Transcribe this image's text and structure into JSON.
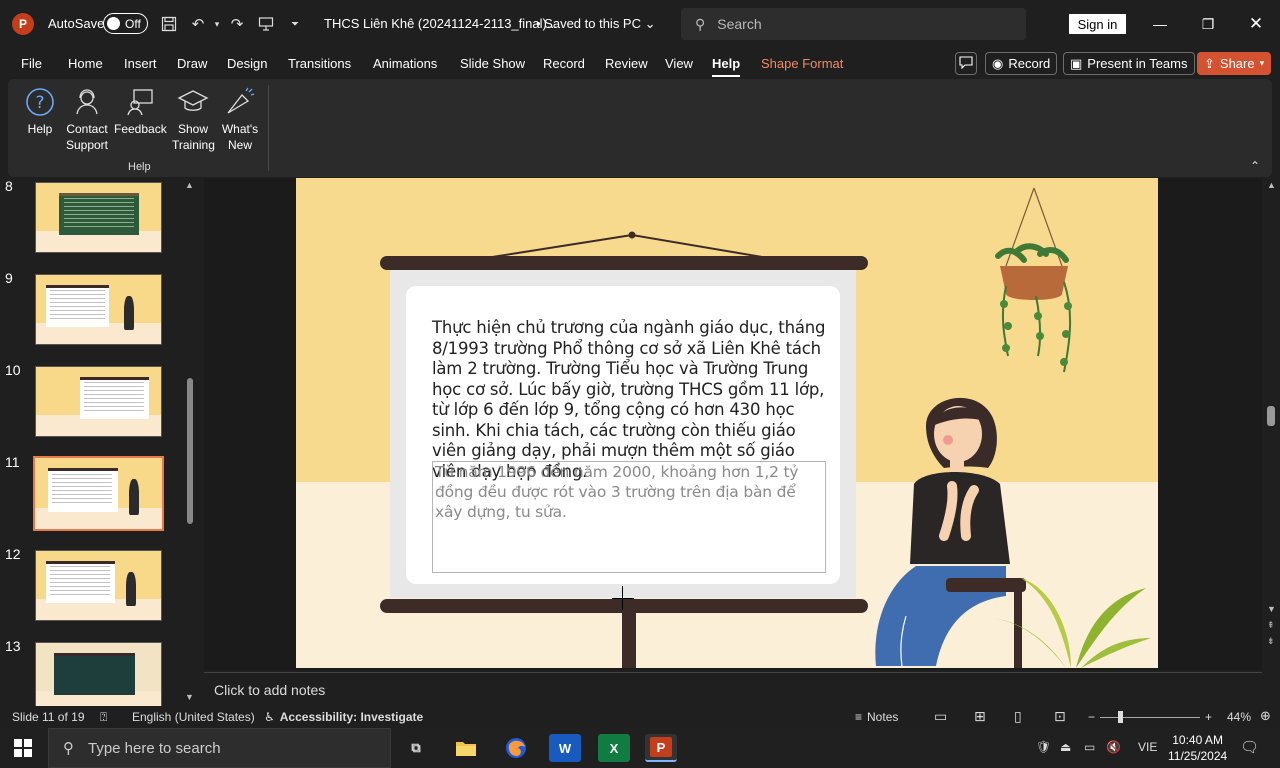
{
  "titlebar": {
    "autosave_label": "AutoSave",
    "autosave_state": "Off",
    "doc_title": "THCS Liên Khê (20241124-2113_final)...",
    "saved_status": "• Saved to this PC",
    "search_placeholder": "Search",
    "signin_label": "Sign in"
  },
  "tabs": [
    "File",
    "Home",
    "Insert",
    "Draw",
    "Design",
    "Transitions",
    "Animations",
    "Slide Show",
    "Record",
    "Review",
    "View",
    "Help",
    "Shape Format"
  ],
  "tab_active": "Help",
  "toolbar_buttons": {
    "record": "Record",
    "present_teams": "Present in Teams",
    "share": "Share"
  },
  "ribbon": {
    "buttons": [
      {
        "label": "Help",
        "icon": "help-icon"
      },
      {
        "label": "Contact Support",
        "icon": "contact-support-icon"
      },
      {
        "label": "Feedback",
        "icon": "feedback-icon"
      },
      {
        "label": "Show Training",
        "icon": "training-icon"
      },
      {
        "label": "What's New",
        "icon": "whats-new-icon"
      }
    ],
    "group_label": "Help"
  },
  "thumbnails": [
    {
      "number": "8",
      "style": "green"
    },
    {
      "number": "9",
      "style": "person"
    },
    {
      "number": "10",
      "style": "plain"
    },
    {
      "number": "11",
      "style": "person",
      "selected": true
    },
    {
      "number": "12",
      "style": "person"
    },
    {
      "number": "13",
      "style": "chalk"
    }
  ],
  "slide": {
    "main_text": "Thực hiện chủ trương của ngành giáo dục, tháng 8/1993 trường Phổ thông cơ sở xã Liên Khê tách làm 2 trường. Trường Tiểu học và Trường Trung học cơ sở. Lúc bấy giờ, trường THCS gồm 11 lớp, từ lớp 6 đến lớp 9, tổng cộng có hơn 430 học sinh. Khi chia tách, các trường còn thiếu giáo viên giảng dạy, phải mượn thêm một số giáo viên dạy hợp đồng.",
    "textbox_text": "Từ năm  1996 đến năm 2000, khoảng hơn 1,2 tỷ đồng đều được rót vào 3 trường trên địa bàn để xây dựng, tu sửa."
  },
  "notes_placeholder": "Click to add notes",
  "statusbar": {
    "slide_count": "Slide 11 of 19",
    "language": "English (United States)",
    "accessibility": "Accessibility: Investigate",
    "notes": "Notes",
    "zoom": "44%"
  },
  "taskbar": {
    "search_placeholder": "Type here to search",
    "language": "VIE",
    "time": "10:40 AM",
    "date": "11/25/2024"
  },
  "colors": {
    "accent": "#d35230",
    "slide_bg": "#f8da8e",
    "selection": "#e8794a"
  }
}
